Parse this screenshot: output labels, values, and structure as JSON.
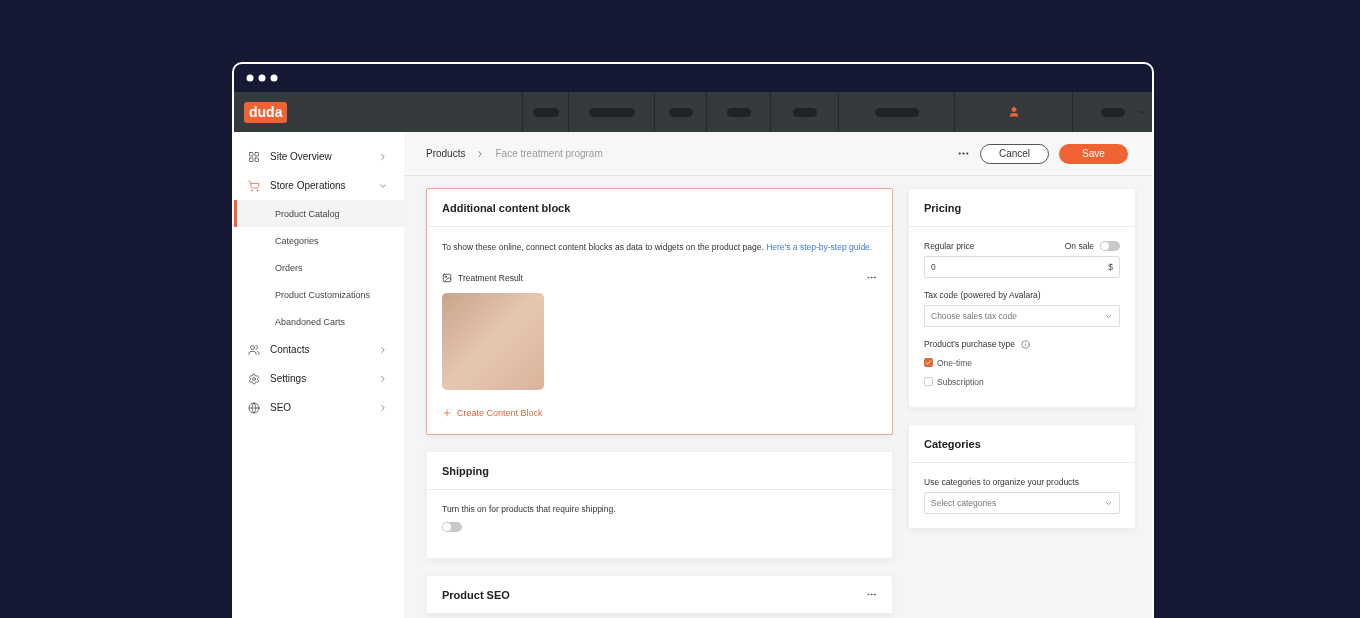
{
  "top_bar": {
    "logo": "duda"
  },
  "sidebar": {
    "items": [
      {
        "label": "Site Overview",
        "expanded": false
      },
      {
        "label": "Store Operations",
        "expanded": true,
        "children": [
          {
            "label": "Product Catalog",
            "selected": true
          },
          {
            "label": "Categories",
            "selected": false
          },
          {
            "label": "Orders",
            "selected": false
          },
          {
            "label": "Product Customizations",
            "selected": false
          },
          {
            "label": "Abandoned Carts",
            "selected": false
          }
        ]
      },
      {
        "label": "Contacts",
        "expanded": false
      },
      {
        "label": "Settings",
        "expanded": false
      },
      {
        "label": "SEO",
        "expanded": false
      }
    ]
  },
  "header": {
    "breadcrumb": [
      "Products",
      "Face treatment program"
    ],
    "cancel": "Cancel",
    "save": "Save"
  },
  "content_block": {
    "title": "Additional content block",
    "description": "To show these online, connect content blocks as data to widgets on the product page.",
    "link": "Here's a step-by-step guide.",
    "item_label": "Treatment Result",
    "create": "Create Content Block"
  },
  "shipping": {
    "title": "Shipping",
    "description": "Turn this on for products that require shipping.",
    "on": false
  },
  "product_seo": {
    "title": "Product SEO"
  },
  "pricing": {
    "title": "Pricing",
    "price_label": "Regular price",
    "sale_label": "On sale",
    "on_sale": false,
    "price": "0",
    "currency": "$",
    "tax_label": "Tax code (powered by Avalara)",
    "tax_placeholder": "Choose sales tax code",
    "purchase_label": "Product's purchase type",
    "options": [
      {
        "label": "One-time",
        "checked": true
      },
      {
        "label": "Subscription",
        "checked": false
      }
    ]
  },
  "categories": {
    "title": "Categories",
    "description": "Use categories to organize your products",
    "placeholder": "Select categories"
  }
}
